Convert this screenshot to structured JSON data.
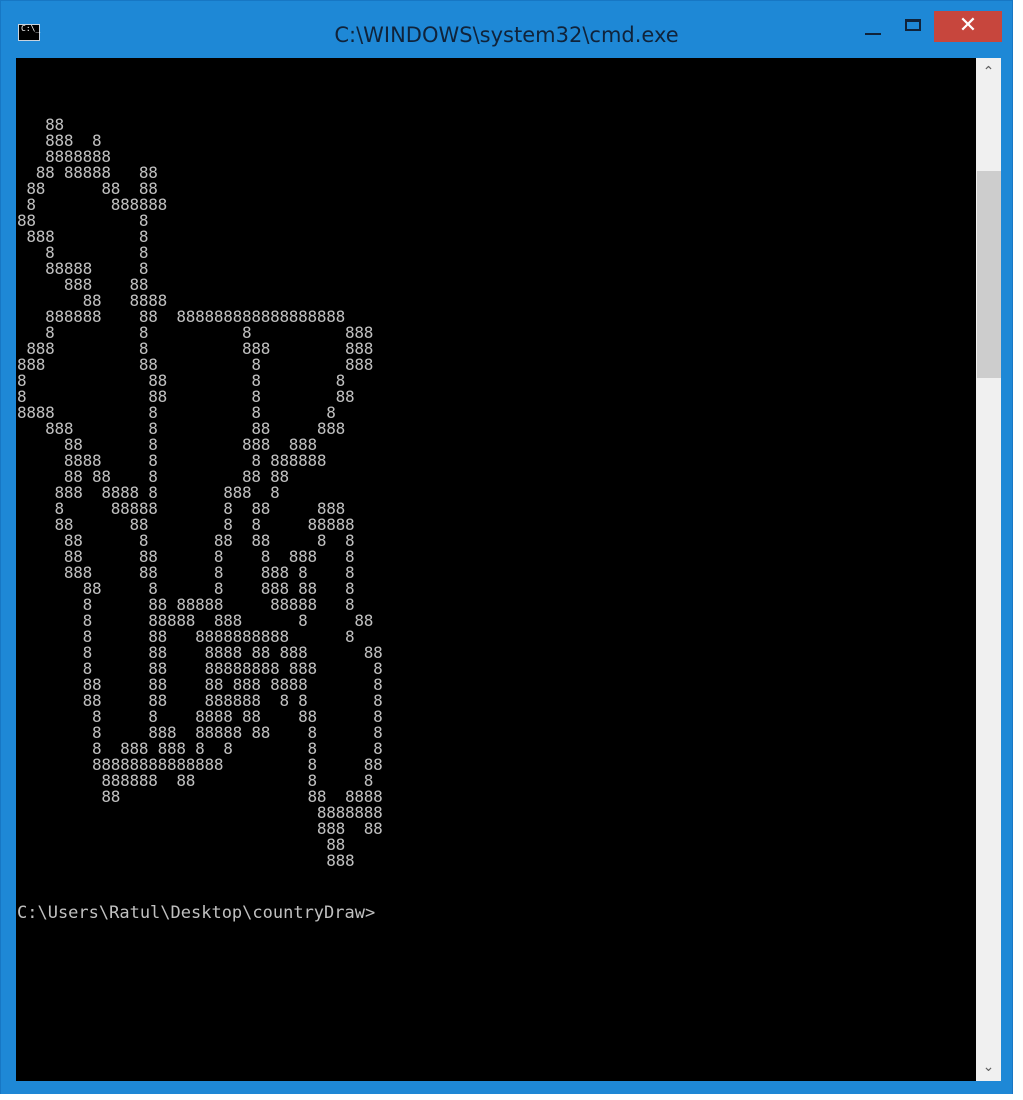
{
  "window": {
    "title": "C:\\WINDOWS\\system32\\cmd.exe",
    "app_icon_glyph": "C:\\_",
    "icons": {
      "app": "console-icon",
      "minimize": "minimize-icon",
      "maximize": "maximize-icon",
      "close": "close-icon"
    },
    "close_glyph": "✕",
    "colors": {
      "frame": "#1e88d6",
      "close_button": "#c7463d",
      "console_background": "#000000",
      "console_text": "#c0c0c0"
    }
  },
  "console": {
    "output": "   88\n   888  8\n   8888888\n  88 88888   88\n 88      88  88\n 8        888888\n88           8\n 888         8\n   8         8\n   88888     8\n     888    88\n       88   8888\n   888888    88  888888888888888888\n   8         8          8          888\n 888         8          888        888\n888          88          8         888\n8             88         8        8\n8             88         8        88\n8888          8          8       8\n   888        8          88     888\n     88       8         888  888\n     8888     8          8 888888\n     88 88    8         88 88\n    888  8888 8       888  8\n    8     88888       8  88     888\n    88      88        8  8     88888\n     88      8       88  88     8  8\n     88      88      8    8  888   8\n     888     88      8    888 8    8\n       88     8      8    888 88   8\n       8      88 88888     88888   8\n       8      88888  888      8     88\n       8      88   8888888888      8\n       8      88    8888 88 888      88\n       8      88    88888888 888      8\n       88     88    88 888 8888       8\n       88     88    888888  8 8       8\n        8     8    8888 88    88      8\n        8     888  88888 88    8      8\n        8  888 888 8  8        8      8\n        88888888888888         8     88\n         888888  88            8     8\n         88                    88  8888\n                                8888888\n                                888  88\n                                 88\n                                 888",
    "prompt": "C:\\Users\\Ratul\\Desktop\\countryDraw>"
  },
  "scrollbar": {
    "up_arrow": "⌃",
    "down_arrow": "⌄",
    "icons": {
      "up": "chevron-up-icon",
      "down": "chevron-down-icon"
    }
  }
}
